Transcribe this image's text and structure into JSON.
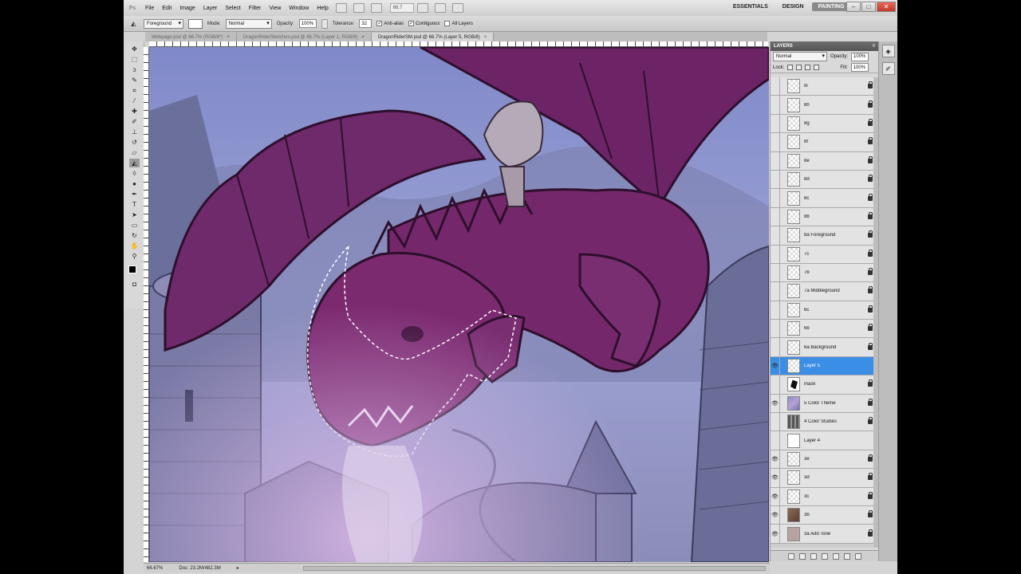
{
  "menubar": {
    "logo": "Ps",
    "items": [
      "File",
      "Edit",
      "Image",
      "Layer",
      "Select",
      "Filter",
      "View",
      "Window",
      "Help"
    ],
    "zoom": "66.7",
    "workspaces": [
      "ESSENTIALS",
      "DESIGN",
      "PAINTING"
    ],
    "active_workspace": "PAINTING",
    "more": "»"
  },
  "options": {
    "sample_source": "Foreground",
    "mode_label": "Mode:",
    "mode_value": "Normal",
    "opacity_label": "Opacity:",
    "opacity_value": "100%",
    "tolerance_label": "Tolerance:",
    "tolerance_value": "32",
    "antialias_label": "Anti-alias",
    "contiguous_label": "Contiguous",
    "all_layers_label": "All Layers"
  },
  "tabs": [
    {
      "label": "Webpage.psd @ 66.7% (RGB/8*)"
    },
    {
      "label": "DragonRiderSketches.psd @ 66.7% (Layer 1, RGB/8)"
    },
    {
      "label": "DragonRiderSM.psd @ 66.7% (Layer 5, RGB/8)"
    }
  ],
  "status": {
    "zoom": "66.67%",
    "doc": "Doc: 23.2M/482.3M"
  },
  "layers_panel": {
    "title": "LAYERS",
    "blend_mode": "Normal",
    "opacity_label": "Opacity:",
    "opacity_value": "100%",
    "lock_label": "Lock:",
    "fill_label": "Fill:",
    "fill_value": "100%",
    "layers": [
      {
        "name": "8i",
        "thumb": "checker",
        "visible": false,
        "locked": true
      },
      {
        "name": "8h",
        "thumb": "checker",
        "visible": false,
        "locked": true
      },
      {
        "name": "8g",
        "thumb": "checker",
        "visible": false,
        "locked": true
      },
      {
        "name": "8f",
        "thumb": "checker",
        "visible": false,
        "locked": true
      },
      {
        "name": "8e",
        "thumb": "checker",
        "visible": false,
        "locked": true
      },
      {
        "name": "8d",
        "thumb": "checker",
        "visible": false,
        "locked": true
      },
      {
        "name": "8c",
        "thumb": "checker",
        "visible": false,
        "locked": true
      },
      {
        "name": "8b",
        "thumb": "checker",
        "visible": false,
        "locked": true
      },
      {
        "name": "8a Foreground",
        "thumb": "checker",
        "visible": false,
        "locked": true
      },
      {
        "name": "7c",
        "thumb": "checker",
        "visible": false,
        "locked": true
      },
      {
        "name": "7b",
        "thumb": "checker",
        "visible": false,
        "locked": true
      },
      {
        "name": "7a Middleground",
        "thumb": "checker",
        "visible": false,
        "locked": true
      },
      {
        "name": "6c",
        "thumb": "checker",
        "visible": false,
        "locked": true
      },
      {
        "name": "6b",
        "thumb": "checker",
        "visible": false,
        "locked": true
      },
      {
        "name": "6a Background",
        "thumb": "checker",
        "visible": false,
        "locked": true
      },
      {
        "name": "Layer 5",
        "thumb": "checker",
        "visible": true,
        "locked": false,
        "selected": true
      },
      {
        "name": "mask",
        "thumb": "mask",
        "visible": false,
        "locked": true
      },
      {
        "name": "5 Color Theme",
        "thumb": "blue",
        "visible": true,
        "locked": true
      },
      {
        "name": "4 Color Studies",
        "thumb": "studies",
        "visible": false,
        "locked": true
      },
      {
        "name": "Layer 4",
        "thumb": "white",
        "visible": false,
        "locked": false
      },
      {
        "name": "3e",
        "thumb": "checker",
        "visible": true,
        "locked": true
      },
      {
        "name": "3d",
        "thumb": "checker",
        "visible": true,
        "locked": true
      },
      {
        "name": "3c",
        "thumb": "checker",
        "visible": true,
        "locked": true
      },
      {
        "name": "3b",
        "thumb": "brown",
        "visible": true,
        "locked": true
      },
      {
        "name": "3a Add Tone",
        "thumb": "tone",
        "visible": true,
        "locked": true
      }
    ]
  },
  "colors": {
    "accent": "#3a8ee6",
    "workspace_active": "#8a8a8a",
    "close_button": "#c0392b",
    "foreground": "#000000",
    "background": "#ffffff"
  }
}
